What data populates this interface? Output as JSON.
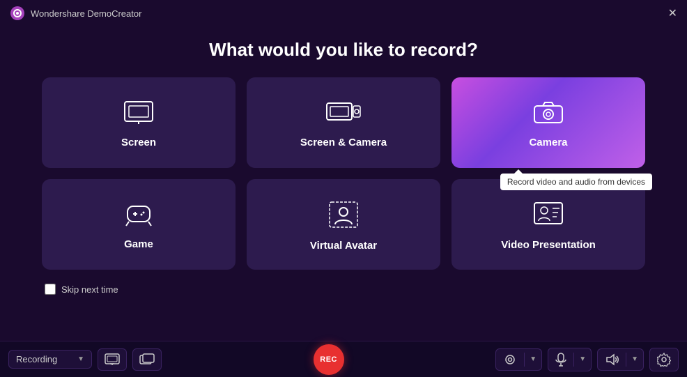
{
  "app": {
    "title": "Wondershare DemoCreator",
    "logo_symbol": "🎬"
  },
  "headline": "What would you like to record?",
  "cards": [
    {
      "id": "screen",
      "label": "Screen",
      "icon": "screen",
      "active": false,
      "tooltip": null
    },
    {
      "id": "screen-camera",
      "label": "Screen & Camera",
      "icon": "screen-camera",
      "active": false,
      "tooltip": null
    },
    {
      "id": "camera",
      "label": "Camera",
      "icon": "camera",
      "active": true,
      "tooltip": "Record video and audio from devices"
    },
    {
      "id": "game",
      "label": "Game",
      "icon": "game",
      "active": false,
      "tooltip": null
    },
    {
      "id": "virtual-avatar",
      "label": "Virtual Avatar",
      "icon": "avatar",
      "active": false,
      "tooltip": null
    },
    {
      "id": "video-presentation",
      "label": "Video Presentation",
      "icon": "presentation",
      "active": false,
      "tooltip": null
    }
  ],
  "skip": {
    "label": "Skip next time",
    "checked": false
  },
  "toolbar": {
    "dropdown_label": "Recording",
    "rec_label": "REC",
    "close_label": "✕"
  }
}
